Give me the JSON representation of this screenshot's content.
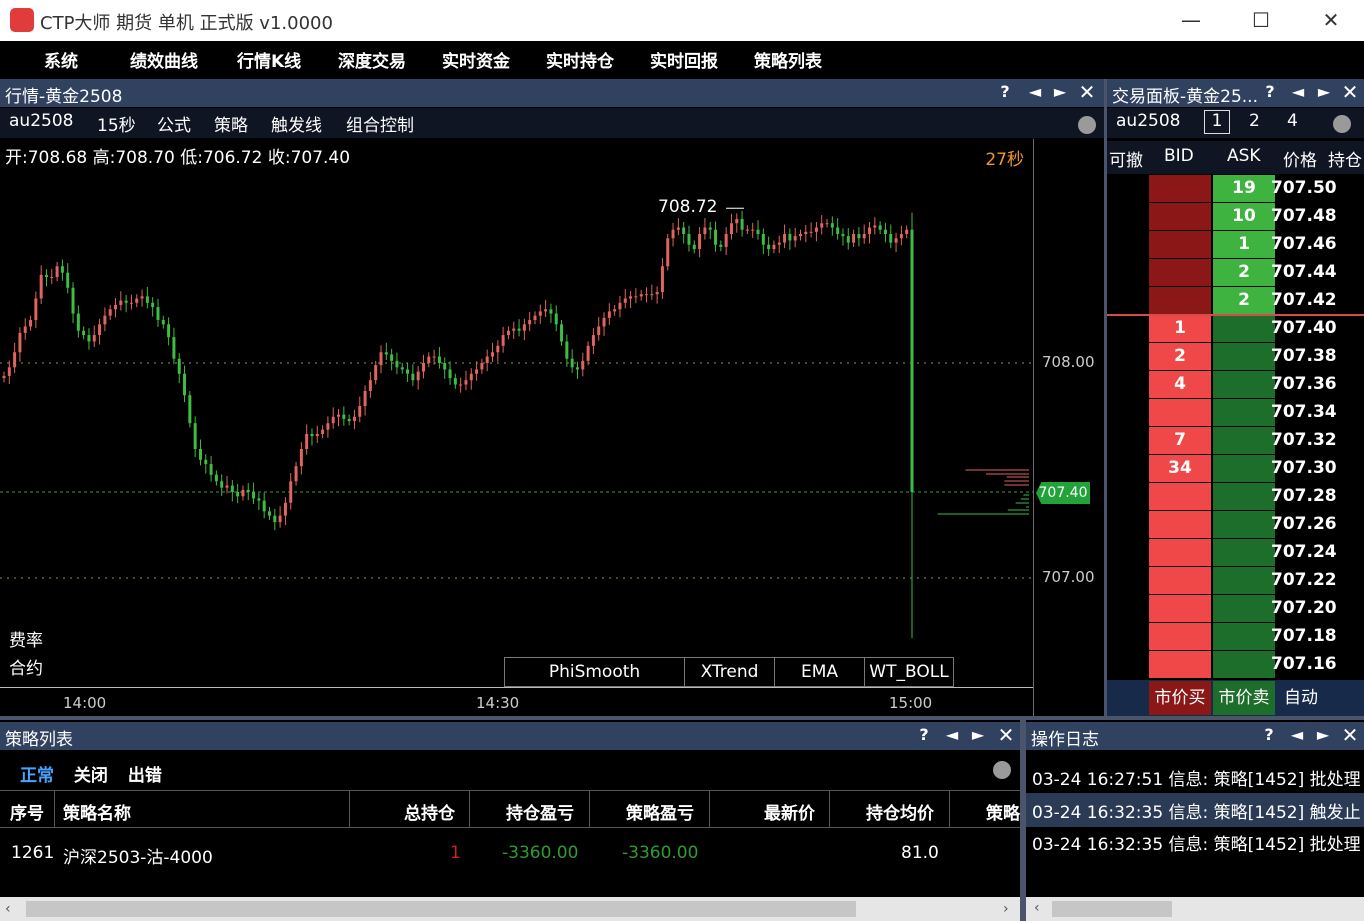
{
  "window": {
    "title": "CTP大师 期货 单机 正式版 v1.0000",
    "minimize": "—",
    "maximize": "☐",
    "close": "✕"
  },
  "menu": [
    "系统",
    "绩效曲线",
    "行情K线",
    "深度交易",
    "实时资金",
    "实时持仓",
    "实时回报",
    "策略列表"
  ],
  "quote_panel": {
    "title": "行情-黄金2508",
    "toolbar": [
      "au2508",
      "15秒",
      "公式",
      "策略",
      "触发线",
      "组合控制"
    ],
    "ohlc_text": "开:708.68 高:708.70 低:706.72 收:707.40",
    "countdown": "27秒",
    "high_label": "708.72",
    "last_price_tag": "707.40",
    "side_labels": [
      "费率",
      "合约"
    ],
    "indicators": [
      "PhiSmooth",
      "XTrend",
      "EMA",
      "WT_BOLL"
    ]
  },
  "chart_data": {
    "type": "line",
    "x_ticks": [
      "14:00",
      "14:30",
      "15:00"
    ],
    "y_ticks": [
      "708.00",
      "707.00"
    ],
    "ylim": [
      706.6,
      709.0
    ],
    "high": 708.72,
    "low": 706.72,
    "last": 707.4,
    "colors": {
      "up": "#e0645f",
      "down": "#3dbd44",
      "grid": "#9a8a5a",
      "last_line": "#2ea33a"
    },
    "close_prices": [
      707.94,
      707.98,
      708.05,
      708.14,
      708.17,
      708.2,
      708.3,
      708.41,
      708.4,
      708.4,
      708.45,
      708.42,
      708.35,
      708.23,
      708.15,
      708.13,
      708.1,
      708.13,
      708.18,
      708.22,
      708.25,
      708.27,
      708.29,
      708.28,
      708.28,
      708.3,
      708.31,
      708.28,
      708.26,
      708.2,
      708.18,
      708.12,
      708.02,
      707.95,
      707.85,
      707.72,
      707.6,
      707.55,
      707.53,
      707.48,
      707.45,
      707.42,
      707.43,
      707.4,
      707.38,
      707.41,
      707.4,
      707.37,
      707.36,
      707.31,
      707.29,
      707.26,
      707.29,
      707.35,
      707.45,
      707.52,
      707.6,
      707.67,
      707.66,
      707.67,
      707.69,
      707.72,
      707.75,
      707.76,
      707.74,
      707.73,
      707.75,
      707.8,
      707.87,
      707.92,
      707.99,
      708.05,
      708.04,
      708.01,
      707.98,
      707.97,
      707.95,
      707.92,
      707.96,
      708.0,
      708.03,
      708.03,
      708.0,
      707.97,
      707.93,
      707.9,
      707.9,
      707.92,
      707.95,
      707.97,
      708.0,
      708.03,
      708.05,
      708.08,
      708.13,
      708.15,
      708.16,
      708.15,
      708.18,
      708.2,
      708.22,
      708.24,
      708.25,
      708.23,
      708.18,
      708.1,
      708.02,
      707.98,
      707.97,
      708.01,
      708.08,
      708.13,
      708.17,
      708.21,
      708.24,
      708.25,
      708.28,
      708.3,
      708.31,
      708.31,
      708.32,
      708.32,
      708.32,
      708.33,
      708.45,
      708.58,
      708.62,
      708.63,
      708.6,
      708.55,
      708.53,
      708.6,
      708.63,
      708.62,
      708.55,
      708.54,
      708.6,
      708.65,
      708.67,
      708.62,
      708.62,
      708.62,
      708.6,
      708.55,
      708.53,
      708.55,
      708.56,
      708.6,
      708.57,
      708.59,
      708.6,
      708.61,
      708.61,
      708.63,
      708.65,
      708.65,
      708.63,
      708.6,
      708.59,
      708.56,
      708.6,
      708.58,
      708.6,
      708.63,
      708.64,
      708.62,
      708.6,
      708.56,
      708.58,
      708.6,
      708.62,
      707.4
    ],
    "depth_lines": {
      "ask_sizes": [
        19,
        10,
        1,
        2,
        2
      ],
      "bid_sizes": [
        1,
        2,
        4,
        0,
        7,
        34
      ]
    }
  },
  "trade_panel": {
    "title": "交易面板-黄金25...",
    "symbol": "au2508",
    "qty_options": [
      "1",
      "2",
      "4"
    ],
    "headers": [
      "可撤",
      "BID",
      "ASK",
      "价格",
      "持仓"
    ],
    "asks": [
      {
        "ask": "19",
        "price": "707.50"
      },
      {
        "ask": "10",
        "price": "707.48"
      },
      {
        "ask": "1",
        "price": "707.46"
      },
      {
        "ask": "2",
        "price": "707.44"
      },
      {
        "ask": "2",
        "price": "707.42"
      }
    ],
    "bids": [
      {
        "bid": "1",
        "price": "707.40"
      },
      {
        "bid": "2",
        "price": "707.38"
      },
      {
        "bid": "4",
        "price": "707.36"
      },
      {
        "bid": "",
        "price": "707.34"
      },
      {
        "bid": "7",
        "price": "707.32"
      },
      {
        "bid": "34",
        "price": "707.30"
      },
      {
        "bid": "",
        "price": "707.28"
      },
      {
        "bid": "",
        "price": "707.26"
      },
      {
        "bid": "",
        "price": "707.24"
      },
      {
        "bid": "",
        "price": "707.22"
      },
      {
        "bid": "",
        "price": "707.20"
      },
      {
        "bid": "",
        "price": "707.18"
      },
      {
        "bid": "",
        "price": "707.16"
      }
    ],
    "buttons": {
      "market_buy": "市价买",
      "market_sell": "市价卖",
      "auto": "自动"
    }
  },
  "strategy_panel": {
    "title": "策略列表",
    "tabs": [
      "正常",
      "关闭",
      "出错"
    ],
    "columns": [
      "序号",
      "策略名称",
      "总持仓",
      "持仓盈亏",
      "策略盈亏",
      "最新价",
      "持仓均价",
      "策略"
    ],
    "rows": [
      {
        "id": "1261",
        "name": "沪深2503-沽-4000",
        "total": "1",
        "pos_pnl": "-3360.00",
        "strat_pnl": "-3360.00",
        "last": "",
        "avg": "81.0"
      }
    ]
  },
  "log_panel": {
    "title": "操作日志",
    "lines": [
      "03-24 16:27:51 信息: 策略[1452] 批处理",
      "03-24 16:32:35 信息: 策略[1452] 触发止",
      "03-24 16:32:35 信息: 策略[1452] 批处理"
    ]
  },
  "panel_controls": {
    "help": "?",
    "prev": "◄",
    "next": "►",
    "close": "✕"
  }
}
